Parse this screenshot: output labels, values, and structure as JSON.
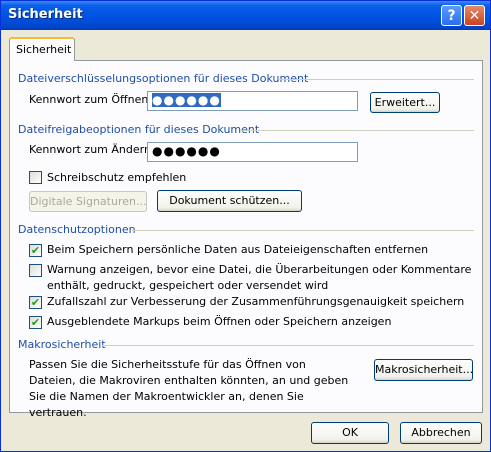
{
  "window": {
    "title": "Sicherheit",
    "help_glyph": "?",
    "close_glyph": "✕"
  },
  "tab": {
    "label": "Sicherheit"
  },
  "encryption": {
    "heading": "Dateiverschlüsselungsoptionen für dieses Dokument",
    "password_label": "Kennwort zum Öffnen:",
    "password_value": "●●●●●●",
    "advanced_button": "Erweitert..."
  },
  "sharing": {
    "heading": "Dateifreigabeoptionen für dieses Dokument",
    "password_label": "Kennwort zum Ändern:",
    "password_value": "●●●●●●",
    "readonly_label": "Schreibschutz empfehlen",
    "readonly_checked": false,
    "digital_signatures_button": "Digitale Signaturen...",
    "protect_button": "Dokument schützen..."
  },
  "privacy": {
    "heading": "Datenschutzoptionen",
    "options": [
      {
        "label": "Beim Speichern persönliche Daten aus Dateieigenschaften entfernen",
        "checked": true
      },
      {
        "label": "Warnung anzeigen, bevor eine Datei, die Überarbeitungen oder Kommentare enthält, gedruckt, gespeichert oder versendet wird",
        "checked": false
      },
      {
        "label": "Zufallszahl zur Verbesserung der Zusammenführungsgenauigkeit speichern",
        "checked": true
      },
      {
        "label": "Ausgeblendete Markups beim Öffnen oder Speichern anzeigen",
        "checked": true
      }
    ]
  },
  "macro": {
    "heading": "Makrosicherheit",
    "description": "Passen Sie die Sicherheitsstufe für das Öffnen von Dateien, die Makroviren enthalten könnten, an und geben Sie die Namen der Makroentwickler an, denen Sie vertrauen.",
    "button": "Makrosicherheit..."
  },
  "footer": {
    "ok_button": "OK",
    "cancel_button": "Abbrechen"
  }
}
